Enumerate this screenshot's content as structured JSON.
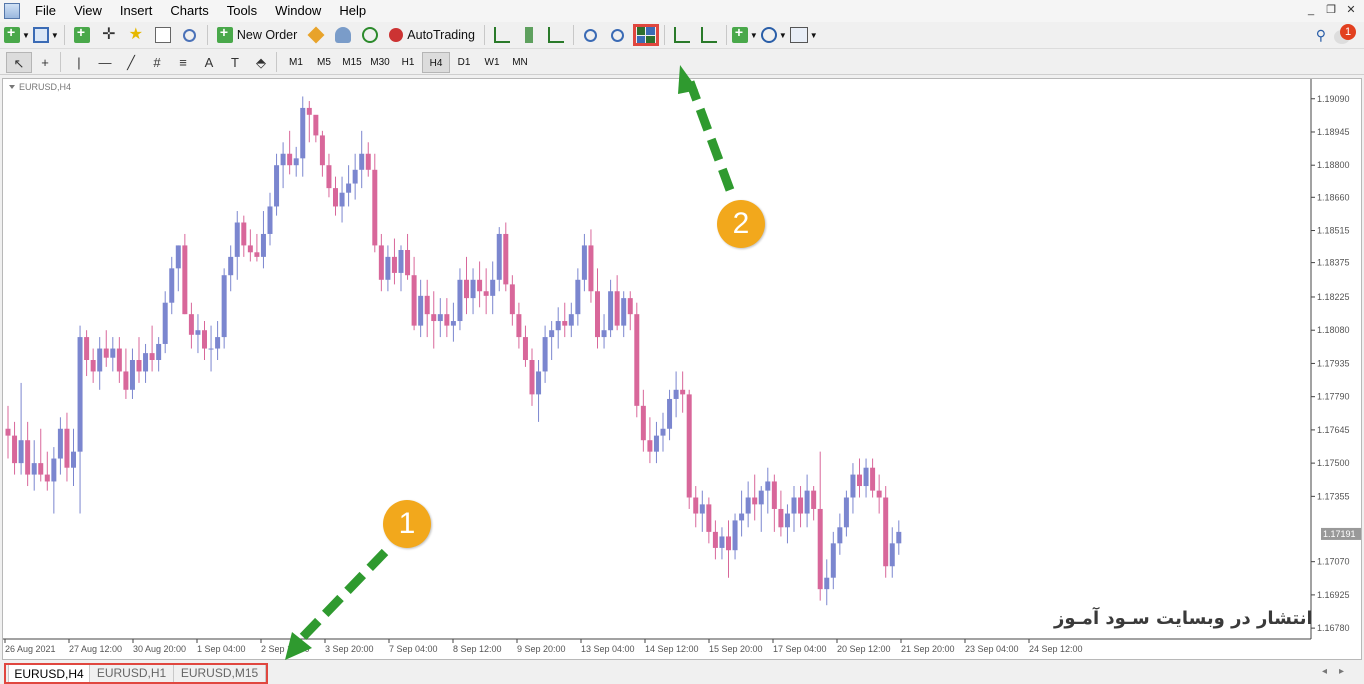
{
  "menu": [
    "File",
    "View",
    "Insert",
    "Charts",
    "Tools",
    "Window",
    "Help"
  ],
  "window_controls": [
    "_",
    "❐",
    "✕"
  ],
  "toolbar": {
    "new_order_label": "New Order",
    "autotrading_label": "AutoTrading"
  },
  "timeframes": [
    "M1",
    "M5",
    "M15",
    "M30",
    "H1",
    "H4",
    "D1",
    "W1",
    "MN"
  ],
  "active_timeframe": "H4",
  "draw_tools": [
    "↖",
    "+",
    "|",
    "—",
    "╱",
    "#",
    "≡",
    "A",
    "T",
    "⬘"
  ],
  "notification_count": "1",
  "chart": {
    "symbol_label": "EURUSD,H4",
    "current_price": "1.17191",
    "price_ticks": [
      "1.19090",
      "1.18945",
      "1.18800",
      "1.18660",
      "1.18515",
      "1.18375",
      "1.18225",
      "1.18080",
      "1.17935",
      "1.17790",
      "1.17645",
      "1.17500",
      "1.17355",
      "1.17070",
      "1.16925",
      "1.16780"
    ],
    "time_ticks": [
      "26 Aug 2021",
      "27 Aug 12:00",
      "30 Aug 20:00",
      "1 Sep 04:00",
      "2 Sep 12:00",
      "3 Sep 20:00",
      "7 Sep 04:00",
      "8 Sep 12:00",
      "9 Sep 20:00",
      "13 Sep 04:00",
      "14 Sep 12:00",
      "15 Sep 20:00",
      "17 Sep 04:00",
      "20 Sep 12:00",
      "21 Sep 20:00",
      "23 Sep 04:00",
      "24 Sep 12:00"
    ]
  },
  "tabs": [
    "EURUSD,H4",
    "EURUSD,H1",
    "EURUSD,M15"
  ],
  "active_tab": "EURUSD,H4",
  "annotations": {
    "badge_1": "1",
    "badge_2": "2"
  },
  "watermark": "انتشار در وبسایت سـود آمـوز",
  "colors": {
    "bull": "#7b86cf",
    "bear": "#d8679a",
    "highlight": "#e0473f",
    "arrow": "#2f9a2f",
    "badge": "#f2a81c"
  },
  "chart_data": {
    "type": "candlestick",
    "symbol": "EURUSD",
    "timeframe": "H4",
    "ylim": [
      1.1675,
      1.1915
    ],
    "ohlc": [
      [
        1.1765,
        1.1775,
        1.1752,
        1.1762
      ],
      [
        1.1762,
        1.1768,
        1.1745,
        1.175
      ],
      [
        1.175,
        1.1785,
        1.1745,
        1.176
      ],
      [
        1.176,
        1.1768,
        1.174,
        1.1745
      ],
      [
        1.1745,
        1.176,
        1.1738,
        1.175
      ],
      [
        1.175,
        1.1765,
        1.1742,
        1.1745
      ],
      [
        1.1745,
        1.1755,
        1.1738,
        1.1742
      ],
      [
        1.1742,
        1.1757,
        1.1728,
        1.1752
      ],
      [
        1.1752,
        1.177,
        1.1745,
        1.1765
      ],
      [
        1.1765,
        1.1772,
        1.1742,
        1.1748
      ],
      [
        1.1748,
        1.1765,
        1.174,
        1.1755
      ],
      [
        1.1755,
        1.181,
        1.1728,
        1.1805
      ],
      [
        1.1805,
        1.1808,
        1.1788,
        1.1795
      ],
      [
        1.1795,
        1.18,
        1.1785,
        1.179
      ],
      [
        1.179,
        1.1805,
        1.1782,
        1.18
      ],
      [
        1.18,
        1.1808,
        1.1792,
        1.1796
      ],
      [
        1.1796,
        1.1805,
        1.179,
        1.18
      ],
      [
        1.18,
        1.1805,
        1.1785,
        1.179
      ],
      [
        1.179,
        1.18,
        1.1778,
        1.1782
      ],
      [
        1.1782,
        1.18,
        1.1778,
        1.1795
      ],
      [
        1.1795,
        1.1805,
        1.1785,
        1.179
      ],
      [
        1.179,
        1.1802,
        1.1785,
        1.1798
      ],
      [
        1.1798,
        1.181,
        1.179,
        1.1795
      ],
      [
        1.1795,
        1.1805,
        1.179,
        1.1802
      ],
      [
        1.1802,
        1.1825,
        1.1798,
        1.182
      ],
      [
        1.182,
        1.184,
        1.1815,
        1.1835
      ],
      [
        1.1835,
        1.1845,
        1.1825,
        1.1845
      ],
      [
        1.1845,
        1.185,
        1.1815,
        1.1815
      ],
      [
        1.1815,
        1.182,
        1.18,
        1.1806
      ],
      [
        1.1806,
        1.1815,
        1.1798,
        1.1808
      ],
      [
        1.1808,
        1.1812,
        1.1795,
        1.18
      ],
      [
        1.18,
        1.181,
        1.179,
        1.18
      ],
      [
        1.18,
        1.1812,
        1.1795,
        1.1805
      ],
      [
        1.1805,
        1.1835,
        1.18,
        1.1832
      ],
      [
        1.1832,
        1.1845,
        1.1825,
        1.184
      ],
      [
        1.184,
        1.186,
        1.183,
        1.1855
      ],
      [
        1.1855,
        1.1858,
        1.184,
        1.1845
      ],
      [
        1.1845,
        1.1852,
        1.1838,
        1.1842
      ],
      [
        1.1842,
        1.185,
        1.1838,
        1.184
      ],
      [
        1.184,
        1.186,
        1.1835,
        1.185
      ],
      [
        1.185,
        1.1868,
        1.1845,
        1.1862
      ],
      [
        1.1862,
        1.1885,
        1.1858,
        1.188
      ],
      [
        1.188,
        1.189,
        1.187,
        1.1885
      ],
      [
        1.1885,
        1.1895,
        1.1876,
        1.188
      ],
      [
        1.188,
        1.1888,
        1.1875,
        1.1883
      ],
      [
        1.1883,
        1.191,
        1.1875,
        1.1905
      ],
      [
        1.1905,
        1.1908,
        1.189,
        1.1902
      ],
      [
        1.1902,
        1.19,
        1.189,
        1.1893
      ],
      [
        1.1893,
        1.1895,
        1.1875,
        1.188
      ],
      [
        1.188,
        1.1885,
        1.1866,
        1.187
      ],
      [
        1.187,
        1.1875,
        1.1858,
        1.1862
      ],
      [
        1.1862,
        1.1875,
        1.1855,
        1.1868
      ],
      [
        1.1868,
        1.188,
        1.1862,
        1.1872
      ],
      [
        1.1872,
        1.1885,
        1.1865,
        1.1878
      ],
      [
        1.1878,
        1.1895,
        1.187,
        1.1885
      ],
      [
        1.1885,
        1.189,
        1.1875,
        1.1878
      ],
      [
        1.1878,
        1.1885,
        1.1842,
        1.1845
      ],
      [
        1.1845,
        1.185,
        1.1825,
        1.183
      ],
      [
        1.183,
        1.1845,
        1.1825,
        1.184
      ],
      [
        1.184,
        1.1848,
        1.1828,
        1.1833
      ],
      [
        1.1833,
        1.1845,
        1.1825,
        1.1843
      ],
      [
        1.1843,
        1.185,
        1.183,
        1.1832
      ],
      [
        1.1832,
        1.184,
        1.1808,
        1.181
      ],
      [
        1.181,
        1.183,
        1.1805,
        1.1823
      ],
      [
        1.1823,
        1.183,
        1.1805,
        1.1815
      ],
      [
        1.1815,
        1.1825,
        1.18,
        1.1812
      ],
      [
        1.1812,
        1.1822,
        1.1805,
        1.1815
      ],
      [
        1.1815,
        1.1822,
        1.1805,
        1.181
      ],
      [
        1.181,
        1.182,
        1.1803,
        1.1812
      ],
      [
        1.1812,
        1.1835,
        1.1808,
        1.183
      ],
      [
        1.183,
        1.184,
        1.1815,
        1.1822
      ],
      [
        1.1822,
        1.1835,
        1.1815,
        1.183
      ],
      [
        1.183,
        1.1838,
        1.1818,
        1.1825
      ],
      [
        1.1825,
        1.1835,
        1.1815,
        1.1823
      ],
      [
        1.1823,
        1.1838,
        1.1815,
        1.183
      ],
      [
        1.183,
        1.1853,
        1.1825,
        1.185
      ],
      [
        1.185,
        1.1855,
        1.1825,
        1.1828
      ],
      [
        1.1828,
        1.1832,
        1.181,
        1.1815
      ],
      [
        1.1815,
        1.182,
        1.18,
        1.1805
      ],
      [
        1.1805,
        1.181,
        1.1792,
        1.1795
      ],
      [
        1.1795,
        1.18,
        1.1775,
        1.178
      ],
      [
        1.178,
        1.1795,
        1.1768,
        1.179
      ],
      [
        1.179,
        1.181,
        1.1785,
        1.1805
      ],
      [
        1.1805,
        1.1812,
        1.1795,
        1.1808
      ],
      [
        1.1808,
        1.1818,
        1.18,
        1.1812
      ],
      [
        1.1812,
        1.182,
        1.1805,
        1.181
      ],
      [
        1.181,
        1.182,
        1.1805,
        1.1815
      ],
      [
        1.1815,
        1.1835,
        1.181,
        1.183
      ],
      [
        1.183,
        1.185,
        1.1825,
        1.1845
      ],
      [
        1.1845,
        1.1852,
        1.182,
        1.1825
      ],
      [
        1.1825,
        1.1835,
        1.18,
        1.1805
      ],
      [
        1.1805,
        1.1815,
        1.18,
        1.1808
      ],
      [
        1.1808,
        1.183,
        1.1805,
        1.1825
      ],
      [
        1.1825,
        1.1832,
        1.1808,
        1.181
      ],
      [
        1.181,
        1.1825,
        1.1805,
        1.1822
      ],
      [
        1.1822,
        1.1825,
        1.1808,
        1.1815
      ],
      [
        1.1815,
        1.182,
        1.177,
        1.1775
      ],
      [
        1.1775,
        1.1782,
        1.1755,
        1.176
      ],
      [
        1.176,
        1.177,
        1.175,
        1.1755
      ],
      [
        1.1755,
        1.1768,
        1.175,
        1.1762
      ],
      [
        1.1762,
        1.1772,
        1.1755,
        1.1765
      ],
      [
        1.1765,
        1.1782,
        1.176,
        1.1778
      ],
      [
        1.1778,
        1.179,
        1.177,
        1.1782
      ],
      [
        1.1782,
        1.179,
        1.1772,
        1.178
      ],
      [
        1.178,
        1.1782,
        1.173,
        1.1735
      ],
      [
        1.1735,
        1.174,
        1.1722,
        1.1728
      ],
      [
        1.1728,
        1.1738,
        1.172,
        1.1732
      ],
      [
        1.1732,
        1.1735,
        1.1715,
        1.172
      ],
      [
        1.172,
        1.1725,
        1.1708,
        1.1713
      ],
      [
        1.1713,
        1.1722,
        1.1708,
        1.1718
      ],
      [
        1.1718,
        1.1725,
        1.17,
        1.1712
      ],
      [
        1.1712,
        1.1728,
        1.1708,
        1.1725
      ],
      [
        1.1725,
        1.1738,
        1.1718,
        1.1728
      ],
      [
        1.1728,
        1.1742,
        1.1722,
        1.1735
      ],
      [
        1.1735,
        1.1745,
        1.1725,
        1.1732
      ],
      [
        1.1732,
        1.174,
        1.172,
        1.1738
      ],
      [
        1.1738,
        1.1748,
        1.1728,
        1.1742
      ],
      [
        1.1742,
        1.1745,
        1.172,
        1.173
      ],
      [
        1.173,
        1.1738,
        1.1718,
        1.1722
      ],
      [
        1.1722,
        1.1732,
        1.1715,
        1.1728
      ],
      [
        1.1728,
        1.174,
        1.172,
        1.1735
      ],
      [
        1.1735,
        1.174,
        1.1722,
        1.1728
      ],
      [
        1.1728,
        1.1745,
        1.1722,
        1.1738
      ],
      [
        1.1738,
        1.174,
        1.1725,
        1.173
      ],
      [
        1.173,
        1.1755,
        1.169,
        1.1695
      ],
      [
        1.1695,
        1.1708,
        1.1688,
        1.17
      ],
      [
        1.17,
        1.172,
        1.1695,
        1.1715
      ],
      [
        1.1715,
        1.1728,
        1.171,
        1.1722
      ],
      [
        1.1722,
        1.1738,
        1.1718,
        1.1735
      ],
      [
        1.1735,
        1.175,
        1.1728,
        1.1745
      ],
      [
        1.1745,
        1.1752,
        1.1735,
        1.174
      ],
      [
        1.174,
        1.1752,
        1.1735,
        1.1748
      ],
      [
        1.1748,
        1.1752,
        1.1735,
        1.1738
      ],
      [
        1.1738,
        1.1745,
        1.1728,
        1.1735
      ],
      [
        1.1735,
        1.174,
        1.17,
        1.1705
      ],
      [
        1.1705,
        1.1722,
        1.17,
        1.1715
      ],
      [
        1.1715,
        1.1725,
        1.171,
        1.172
      ]
    ]
  }
}
